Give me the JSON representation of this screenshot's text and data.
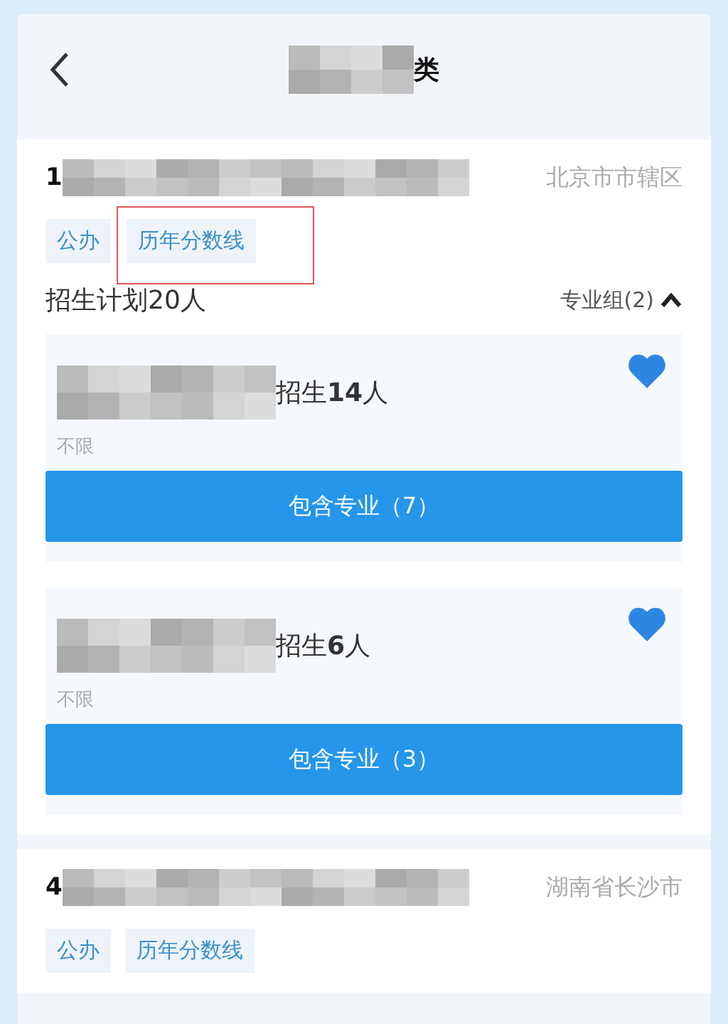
{
  "header": {
    "title": "类"
  },
  "schools": [
    {
      "code": "1",
      "location": "北京市市辖区",
      "tags": [
        {
          "label": "公办",
          "highlighted": false
        },
        {
          "label": "历年分数线",
          "highlighted": true
        }
      ],
      "plan": "招生计划20人",
      "group_toggle": {
        "label": "专业组(2)",
        "expanded": true
      },
      "groups": [
        {
          "enroll": "招生**14**人",
          "limit": "不限",
          "favorited": true,
          "button": "包含专业（7）"
        },
        {
          "enroll": "招生**6**人",
          "limit": "不限",
          "favorited": true,
          "button": "包含专业（3）"
        }
      ]
    },
    {
      "code": "4",
      "location": "湖南省长沙市",
      "tags": [
        {
          "label": "公办",
          "highlighted": false
        },
        {
          "label": "历年分数线",
          "highlighted": false
        }
      ]
    }
  ]
}
